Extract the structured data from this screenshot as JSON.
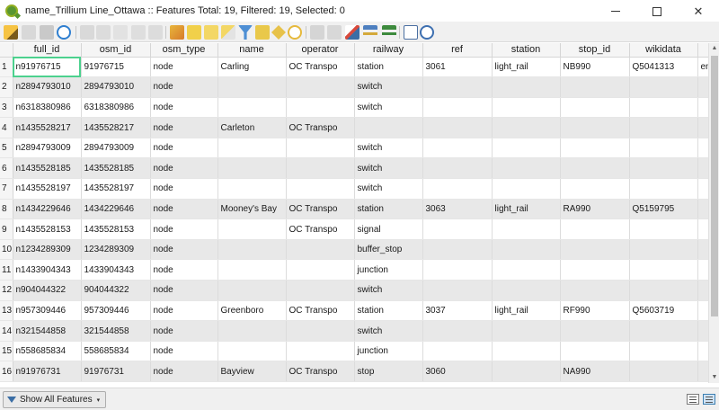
{
  "window": {
    "title": "name_Trillium Line_Ottawa :: Features Total: 19, Filtered: 19, Selected: 0",
    "minimize_icon": "minimize-icon",
    "maximize_icon": "maximize-icon",
    "close_icon": "close-icon",
    "close_glyph": "✕"
  },
  "toolbar": {
    "icons": [
      "pencil-edit-icon",
      "multi-edit-icon",
      "save-edits-icon",
      "reload-icon",
      "add-feature-icon",
      "delete-feature-icon",
      "cut-icon",
      "copy-icon",
      "paste-icon",
      "expression-select-icon",
      "select-all-icon",
      "invert-selection-icon",
      "deselect-all-icon",
      "filter-selected-icon",
      "move-selection-top-icon",
      "pan-to-selected-icon",
      "zoom-to-selected-icon",
      "new-field-icon",
      "delete-field-icon",
      "field-calculator-icon",
      "conditional-formatting-icon",
      "actions-icon",
      "dock-icon",
      "help-icon"
    ]
  },
  "table": {
    "columns": [
      "full_id",
      "osm_id",
      "osm_type",
      "name",
      "operator",
      "railway",
      "ref",
      "station",
      "stop_id",
      "wikidata",
      ""
    ],
    "rows": [
      {
        "num": "1",
        "cells": [
          "n91976715",
          "91976715",
          "node",
          "Carling",
          "OC Transpo",
          "station",
          "3061",
          "light_rail",
          "NB990",
          "Q5041313",
          "en:"
        ]
      },
      {
        "num": "2",
        "cells": [
          "n2894793010",
          "2894793010",
          "node",
          "",
          "",
          "switch",
          "",
          "",
          "",
          "",
          ""
        ]
      },
      {
        "num": "3",
        "cells": [
          "n6318380986",
          "6318380986",
          "node",
          "",
          "",
          "switch",
          "",
          "",
          "",
          "",
          ""
        ]
      },
      {
        "num": "4",
        "cells": [
          "n1435528217",
          "1435528217",
          "node",
          "Carleton",
          "OC Transpo",
          "",
          "",
          "",
          "",
          "",
          ""
        ]
      },
      {
        "num": "5",
        "cells": [
          "n2894793009",
          "2894793009",
          "node",
          "",
          "",
          "switch",
          "",
          "",
          "",
          "",
          ""
        ]
      },
      {
        "num": "6",
        "cells": [
          "n1435528185",
          "1435528185",
          "node",
          "",
          "",
          "switch",
          "",
          "",
          "",
          "",
          ""
        ]
      },
      {
        "num": "7",
        "cells": [
          "n1435528197",
          "1435528197",
          "node",
          "",
          "",
          "switch",
          "",
          "",
          "",
          "",
          ""
        ]
      },
      {
        "num": "8",
        "cells": [
          "n1434229646",
          "1434229646",
          "node",
          "Mooney's Bay",
          "OC Transpo",
          "station",
          "3063",
          "light_rail",
          "RA990",
          "Q5159795",
          ""
        ]
      },
      {
        "num": "9",
        "cells": [
          "n1435528153",
          "1435528153",
          "node",
          "",
          "OC Transpo",
          "signal",
          "",
          "",
          "",
          "",
          ""
        ]
      },
      {
        "num": "10",
        "cells": [
          "n1234289309",
          "1234289309",
          "node",
          "",
          "",
          "buffer_stop",
          "",
          "",
          "",
          "",
          ""
        ]
      },
      {
        "num": "11",
        "cells": [
          "n1433904343",
          "1433904343",
          "node",
          "",
          "",
          "junction",
          "",
          "",
          "",
          "",
          ""
        ]
      },
      {
        "num": "12",
        "cells": [
          "n904044322",
          "904044322",
          "node",
          "",
          "",
          "switch",
          "",
          "",
          "",
          "",
          ""
        ]
      },
      {
        "num": "13",
        "cells": [
          "n957309446",
          "957309446",
          "node",
          "Greenboro",
          "OC Transpo",
          "station",
          "3037",
          "light_rail",
          "RF990",
          "Q5603719",
          ""
        ]
      },
      {
        "num": "14",
        "cells": [
          "n321544858",
          "321544858",
          "node",
          "",
          "",
          "switch",
          "",
          "",
          "",
          "",
          ""
        ]
      },
      {
        "num": "15",
        "cells": [
          "n558685834",
          "558685834",
          "node",
          "",
          "",
          "junction",
          "",
          "",
          "",
          "",
          ""
        ]
      },
      {
        "num": "16",
        "cells": [
          "n91976731",
          "91976731",
          "node",
          "Bayview",
          "OC Transpo",
          "stop",
          "3060",
          "",
          "NA990",
          "",
          ""
        ]
      }
    ]
  },
  "bottom": {
    "filter_label": "Show All Features",
    "filter_icon": "funnel-icon",
    "form_view_icon": "form-view-icon",
    "table_view_icon": "table-view-icon"
  },
  "colors": {
    "qgis_green": "#589632",
    "selection_outline": "#4cd18e",
    "alt_row": "#e8e8e8"
  }
}
